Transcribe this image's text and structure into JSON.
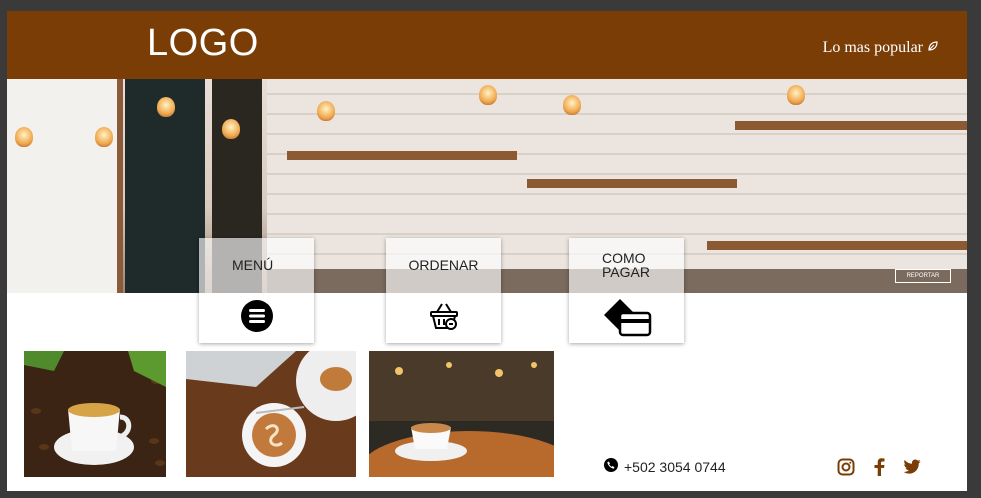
{
  "header": {
    "logo": "LOGO",
    "popular_label": "Lo mas popular"
  },
  "hero": {
    "report_label": "REPORTAR"
  },
  "nav_cards": [
    {
      "label": "MENÚ",
      "icon": "menu-icon"
    },
    {
      "label": "ORDENAR",
      "icon": "basket-icon"
    },
    {
      "label": "COMO PAGAR",
      "icon": "payment-card-icon"
    }
  ],
  "gallery": [
    {
      "subject": "coffee-beans-cup"
    },
    {
      "subject": "latte-art-laptop"
    },
    {
      "subject": "cafe-table-cup"
    }
  ],
  "footer": {
    "phone": "+502 3054 0744",
    "social": [
      "instagram-icon",
      "facebook-icon",
      "twitter-icon"
    ]
  },
  "colors": {
    "header_bg": "#7a3d06",
    "icon": "#000000",
    "text_dark": "#222222"
  }
}
